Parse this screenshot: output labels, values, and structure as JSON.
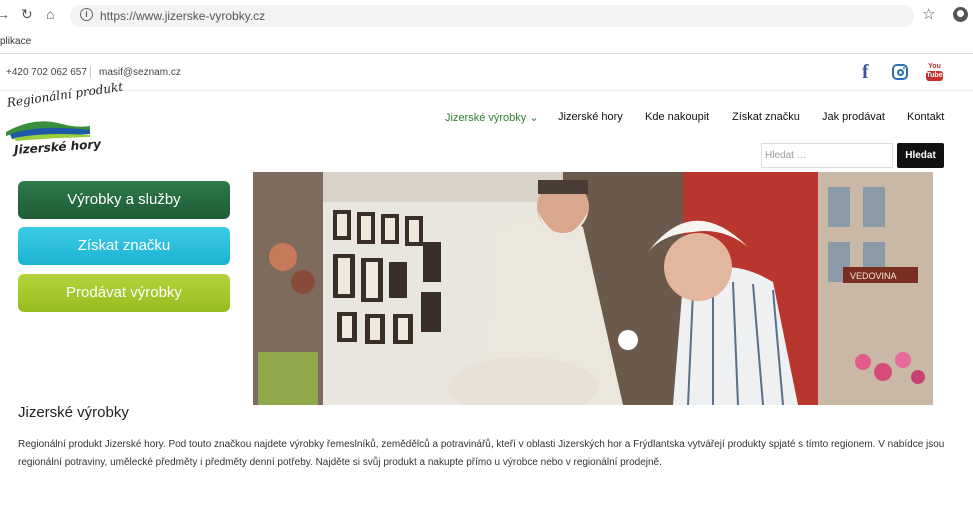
{
  "browser": {
    "url": "https://www.jizerske-vyrobky.cz",
    "bookmark": "plikace"
  },
  "topbar": {
    "phone": "+420 702 062 657",
    "email": "masif@seznam.cz"
  },
  "social": {
    "facebook": "f",
    "youtube_top": "You",
    "youtube_bottom": "Tube"
  },
  "logo": {
    "top_text": "Regionální produkt",
    "bottom_text": "Jizerské hory"
  },
  "nav": {
    "items": [
      {
        "label": "Jizerské výrobky ⌄"
      },
      {
        "label": "Jizerské hory"
      },
      {
        "label": "Kde nakoupit"
      },
      {
        "label": "Získat značku"
      },
      {
        "label": "Jak prodávat"
      },
      {
        "label": "Kontakt"
      }
    ]
  },
  "search": {
    "placeholder": "Hledat …",
    "button": "Hledat"
  },
  "side_buttons": {
    "products": "Výrobky a služby",
    "get_brand": "Získat značku",
    "sell": "Prodávat výrobky"
  },
  "hero": {
    "sign": "VEDOVINA"
  },
  "content": {
    "title": "Jizerské výrobky",
    "text": "Regionální produkt Jizerské hory. Pod touto značkou najdete výrobky řemeslníků, zemědělců a potravinářů, kteří v oblasti Jizerských hor a Frýdlantska vytvářejí produkty spjaté s tímto regionem. V nabídce jsou regionální potraviny, umělecké předměty i předměty denní potřeby. Najděte si svůj produkt a nakupte přímo u výrobce nebo v regionální prodejně."
  }
}
